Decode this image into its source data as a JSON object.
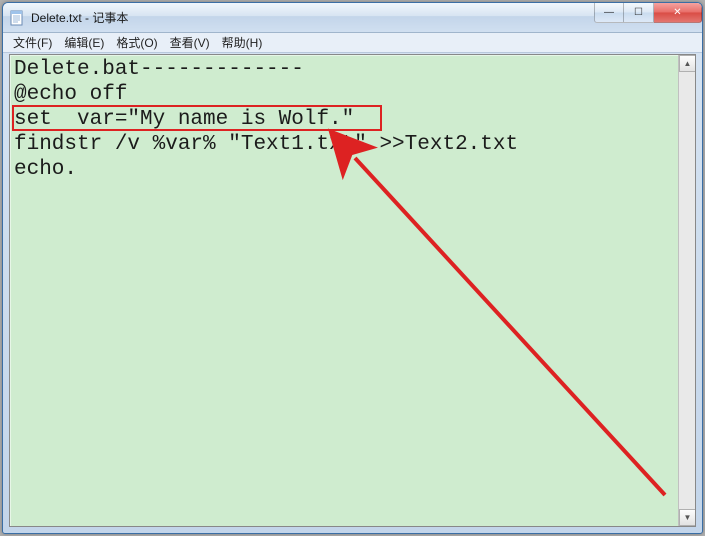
{
  "window": {
    "title": "Delete.txt - 记事本"
  },
  "menu": {
    "file": "文件(F)",
    "edit": "编辑(E)",
    "format": "格式(O)",
    "view": "查看(V)",
    "help": "帮助(H)"
  },
  "editor": {
    "line1": "Delete.bat-------------",
    "line2": "@echo off",
    "line3": "set  var=\"My name is Wolf.\"",
    "line4": "findstr /v %var% \"Text1.txt\" >>Text2.txt",
    "line5": "echo."
  },
  "icons": {
    "minimize": "—",
    "maximize": "☐",
    "close": "✕",
    "scroll_up": "▲",
    "scroll_down": "▼"
  },
  "annotation": {
    "highlight_target": "line3",
    "arrow": "red-arrow"
  }
}
